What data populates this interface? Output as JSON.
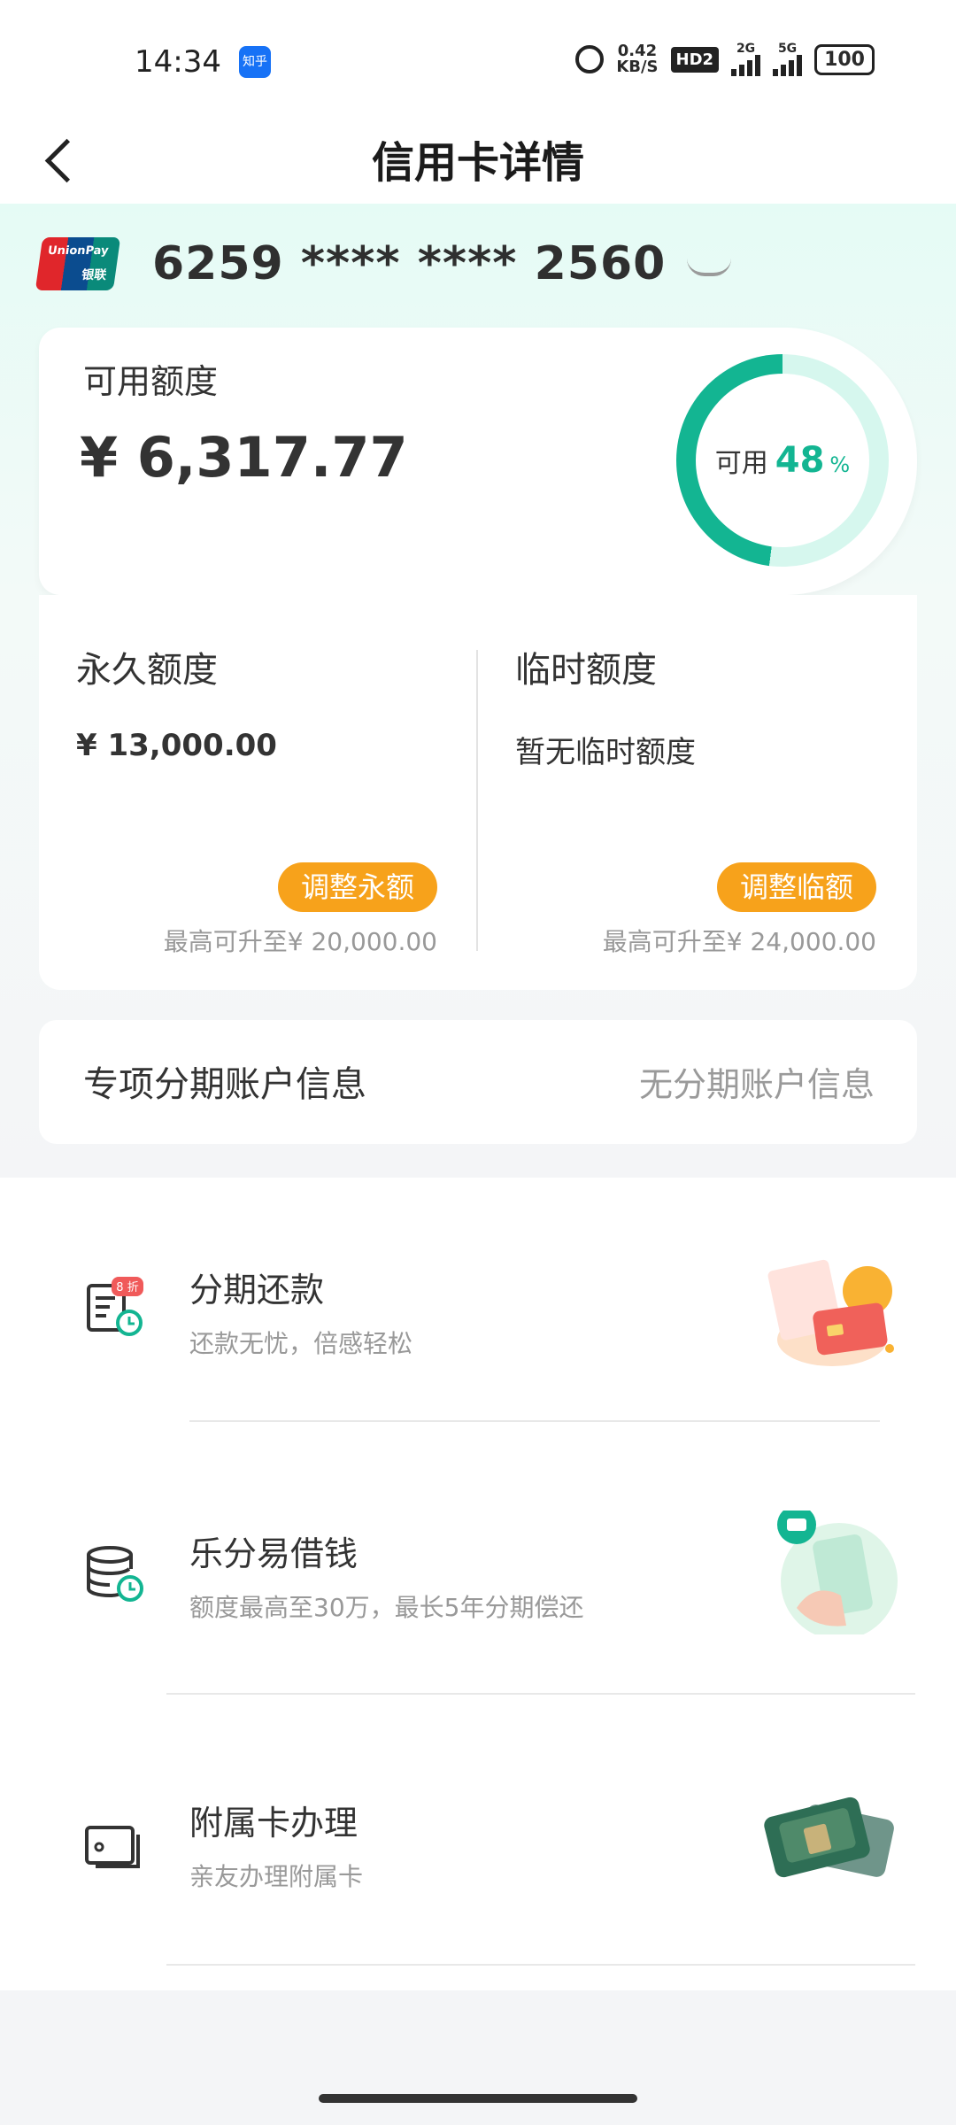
{
  "status_bar": {
    "time": "14:34",
    "app_badge": "知乎",
    "speed_value": "0.42",
    "speed_unit": "KB/S",
    "hd": "HD2",
    "sig1": "2G",
    "sig2": "5G",
    "battery": "100"
  },
  "header": {
    "title": "信用卡详情"
  },
  "card": {
    "number": "6259 **** **** 2560",
    "brand_text": "UnionPay",
    "brand_cn": "银联"
  },
  "available": {
    "label": "可用额度",
    "amount": "¥ 6,317.77",
    "ring_label": "可用",
    "ring_percent": "48",
    "ring_percent_sign": "%",
    "ring_fraction": 0.48
  },
  "quota": {
    "permanent": {
      "title": "永久额度",
      "value": "¥ 13,000.00",
      "button": "调整永额",
      "max": "最高可升至¥ 20,000.00"
    },
    "temporary": {
      "title": "临时额度",
      "value": "暂无临时额度",
      "button": "调整临额",
      "max": "最高可升至¥ 24,000.00"
    }
  },
  "installment_account": {
    "label": "专项分期账户信息",
    "value": "无分期账户信息"
  },
  "services": [
    {
      "name": "分期还款",
      "desc": "还款无忧，倍感轻松",
      "badge": "8 折",
      "icon": "installment-bill-icon"
    },
    {
      "name": "乐分易借钱",
      "desc": "额度最高至30万，最长5年分期偿还",
      "icon": "coin-stack-icon"
    },
    {
      "name": "附属卡办理",
      "desc": "亲友办理附属卡",
      "icon": "card-icon"
    }
  ],
  "colors": {
    "accent": "#13b592",
    "orange": "#f7a21b",
    "ring_light": "#d6f7ee"
  }
}
